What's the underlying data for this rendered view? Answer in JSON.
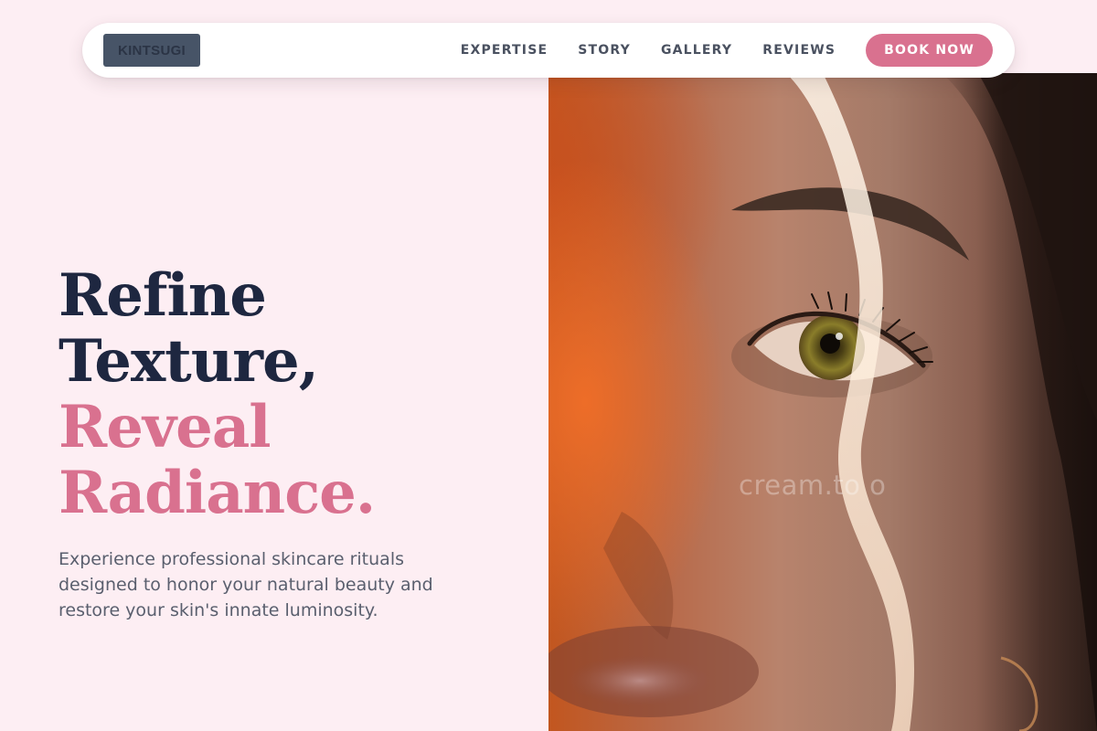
{
  "header": {
    "logo_text": "KINTSUGI",
    "nav": [
      "EXPERTISE",
      "STORY",
      "GALLERY",
      "REVIEWS"
    ],
    "cta_label": "BOOK NOW"
  },
  "hero": {
    "headline_line1": "Refine",
    "headline_line2": "Texture,",
    "headline_line3": "Reveal",
    "headline_line4": "Radiance.",
    "subtext": "Experience professional skincare rituals designed to honor your natural beauty and restore your skin's innate luminosity.",
    "image_watermark": "cream.to  o"
  },
  "colors": {
    "background": "#fdeef3",
    "accent_pink": "#d9718f",
    "headline_dark": "#1e2740",
    "nav_text": "#4a5160",
    "logo_bg": "#475467"
  },
  "icons": {
    "hero_image": "portrait-photo"
  }
}
